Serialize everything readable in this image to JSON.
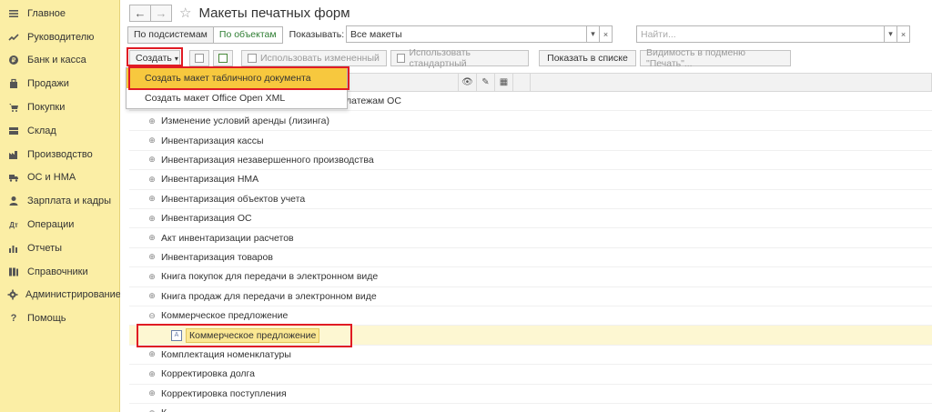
{
  "sidebar": {
    "items": [
      {
        "label": "Главное",
        "icon": "menu-icon"
      },
      {
        "label": "Руководителю",
        "icon": "trend-icon"
      },
      {
        "label": "Банк и касса",
        "icon": "bank-icon"
      },
      {
        "label": "Продажи",
        "icon": "bag-icon"
      },
      {
        "label": "Покупки",
        "icon": "cart-icon"
      },
      {
        "label": "Склад",
        "icon": "warehouse-icon"
      },
      {
        "label": "Производство",
        "icon": "factory-icon"
      },
      {
        "label": "ОС и НМА",
        "icon": "truck-icon"
      },
      {
        "label": "Зарплата и кадры",
        "icon": "person-icon"
      },
      {
        "label": "Операции",
        "icon": "operations-icon"
      },
      {
        "label": "Отчеты",
        "icon": "bar-chart-icon"
      },
      {
        "label": "Справочники",
        "icon": "books-icon"
      },
      {
        "label": "Администрирование",
        "icon": "gear-icon"
      },
      {
        "label": "Помощь",
        "icon": "question-icon"
      }
    ]
  },
  "header": {
    "title": "Макеты печатных форм",
    "back_glyph": "←",
    "forward_glyph": "→",
    "star_glyph": "☆"
  },
  "filters": {
    "by_subsystems": "По подсистемам",
    "by_objects": "По объектам",
    "show_label": "Показывать:",
    "show_value": "Все макеты",
    "search_placeholder": "Найти..."
  },
  "toolbar": {
    "create": "Создать",
    "use_modified": "Использовать измененный",
    "use_standard": "Использовать стандартный",
    "show_in_list": "Показать в списке",
    "visibility": "Видимость в подменю \"Печать\"..."
  },
  "create_menu": {
    "items": [
      "Создать макет табличного документа",
      "Создать макет Office Open XML"
    ]
  },
  "tree": {
    "first_row_tail": "латежам ОС",
    "rows": [
      {
        "label": "Изменение условий аренды (лизинга)",
        "exp": "⊕"
      },
      {
        "label": "Инвентаризация кассы",
        "exp": "⊕"
      },
      {
        "label": "Инвентаризация незавершенного производства",
        "exp": "⊕"
      },
      {
        "label": "Инвентаризация НМА",
        "exp": "⊕"
      },
      {
        "label": "Инвентаризация объектов учета",
        "exp": "⊕"
      },
      {
        "label": "Инвентаризация ОС",
        "exp": "⊕"
      },
      {
        "label": "Акт инвентаризации расчетов",
        "exp": "⊕"
      },
      {
        "label": "Инвентаризация товаров",
        "exp": "⊕"
      },
      {
        "label": "Книга покупок для передачи в электронном виде",
        "exp": "⊕"
      },
      {
        "label": "Книга продаж для передачи в электронном виде",
        "exp": "⊕"
      },
      {
        "label": "Коммерческое предложение",
        "exp": "⊖"
      }
    ],
    "selected_leaf": "Коммерческое предложение",
    "rows_after": [
      {
        "label": "Комплектация номенклатуры",
        "exp": "⊕"
      },
      {
        "label": "Корректировка долга",
        "exp": "⊕"
      },
      {
        "label": "Корректировка поступления",
        "exp": "⊕"
      },
      {
        "label": "К...",
        "exp": "⊕"
      }
    ]
  },
  "colors": {
    "sidebar_bg": "#fbeea5",
    "menu_highlight": "#f7c83e",
    "annotation_red": "#e01b24",
    "active_green": "#2e7d32"
  }
}
